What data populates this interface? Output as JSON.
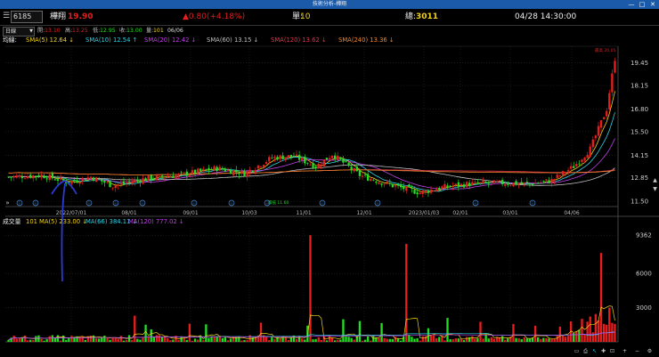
{
  "window": {
    "title": "技術分析-樺翔"
  },
  "quote": {
    "code": "6185",
    "name": "樺翔",
    "price": "19.90",
    "change": "▲0.80(+4.18%)",
    "single_label": "單:",
    "single_value": "10",
    "total_label": "總:",
    "total_value": "3011",
    "datetime": "04/28 14:30:00"
  },
  "ohlc": {
    "period": "日線",
    "open_label": "開:",
    "open": "13.10",
    "high_label": "高:",
    "high": "13.25",
    "low_label": "低:",
    "low": "12.95",
    "close_label": "收:",
    "close": "13.00",
    "vol_label": "量:",
    "vol": "101",
    "date": "06/06"
  },
  "ma_legend": {
    "label": "均線:",
    "items": [
      {
        "text": "SMA(5) 12.64 ↓",
        "color": "#f2d21b"
      },
      {
        "text": "SMA(10) 12.54 ↑",
        "color": "#2bd3e6"
      },
      {
        "text": "SMA(20) 12.42 ↓",
        "color": "#c23ee8"
      },
      {
        "text": "SMA(60) 13.15 ↓",
        "color": "#bfbfbf"
      },
      {
        "text": "SMA(120) 13.62 ↓",
        "color": "#e8324a"
      },
      {
        "text": "SMA(240) 13.36 ↓",
        "color": "#f0862b"
      }
    ]
  },
  "vol_legend": {
    "label": "成交量",
    "value": "101",
    "items": [
      {
        "text": "MA(5) 233.00 ↓",
        "color": "#f2d21b"
      },
      {
        "text": "MA(66) 384.11 ↓",
        "color": "#2bd3e6"
      },
      {
        "text": "MA(120) 777.02 ↓",
        "color": "#c23ee8"
      }
    ]
  },
  "chart_data": [
    {
      "type": "candlestick",
      "y_ticks": [
        "19.45",
        "18.15",
        "16.80",
        "15.50",
        "14.15",
        "12.85",
        "11.50"
      ],
      "ylim": [
        11.2,
        20.4
      ],
      "x_ticks": [
        "2022/07/01",
        "08/01",
        "09/01",
        "10/03",
        "11/01",
        "12/01",
        "2023/01/03",
        "02/01",
        "03/01",
        "04/06"
      ],
      "annotations": [
        {
          "text": "最低 11.60"
        },
        {
          "text": "最高 20.05"
        }
      ],
      "marks": [
        "ⓔ",
        "ⓔ",
        "ⓔ",
        "ⓔ",
        "ⓔ",
        "ⓔ",
        "ⓔ",
        "ⓔ",
        "ⓔ",
        "ⓔ",
        "ⓔ",
        "ⓔ"
      ]
    },
    {
      "type": "bar",
      "title": "成交量",
      "y_ticks": [
        "9362",
        "6000",
        "3000"
      ],
      "ylim": [
        0,
        10000
      ]
    }
  ],
  "colors": {
    "up": "#e61e1e",
    "down": "#22dd22",
    "accent": "#1b5aa8"
  }
}
